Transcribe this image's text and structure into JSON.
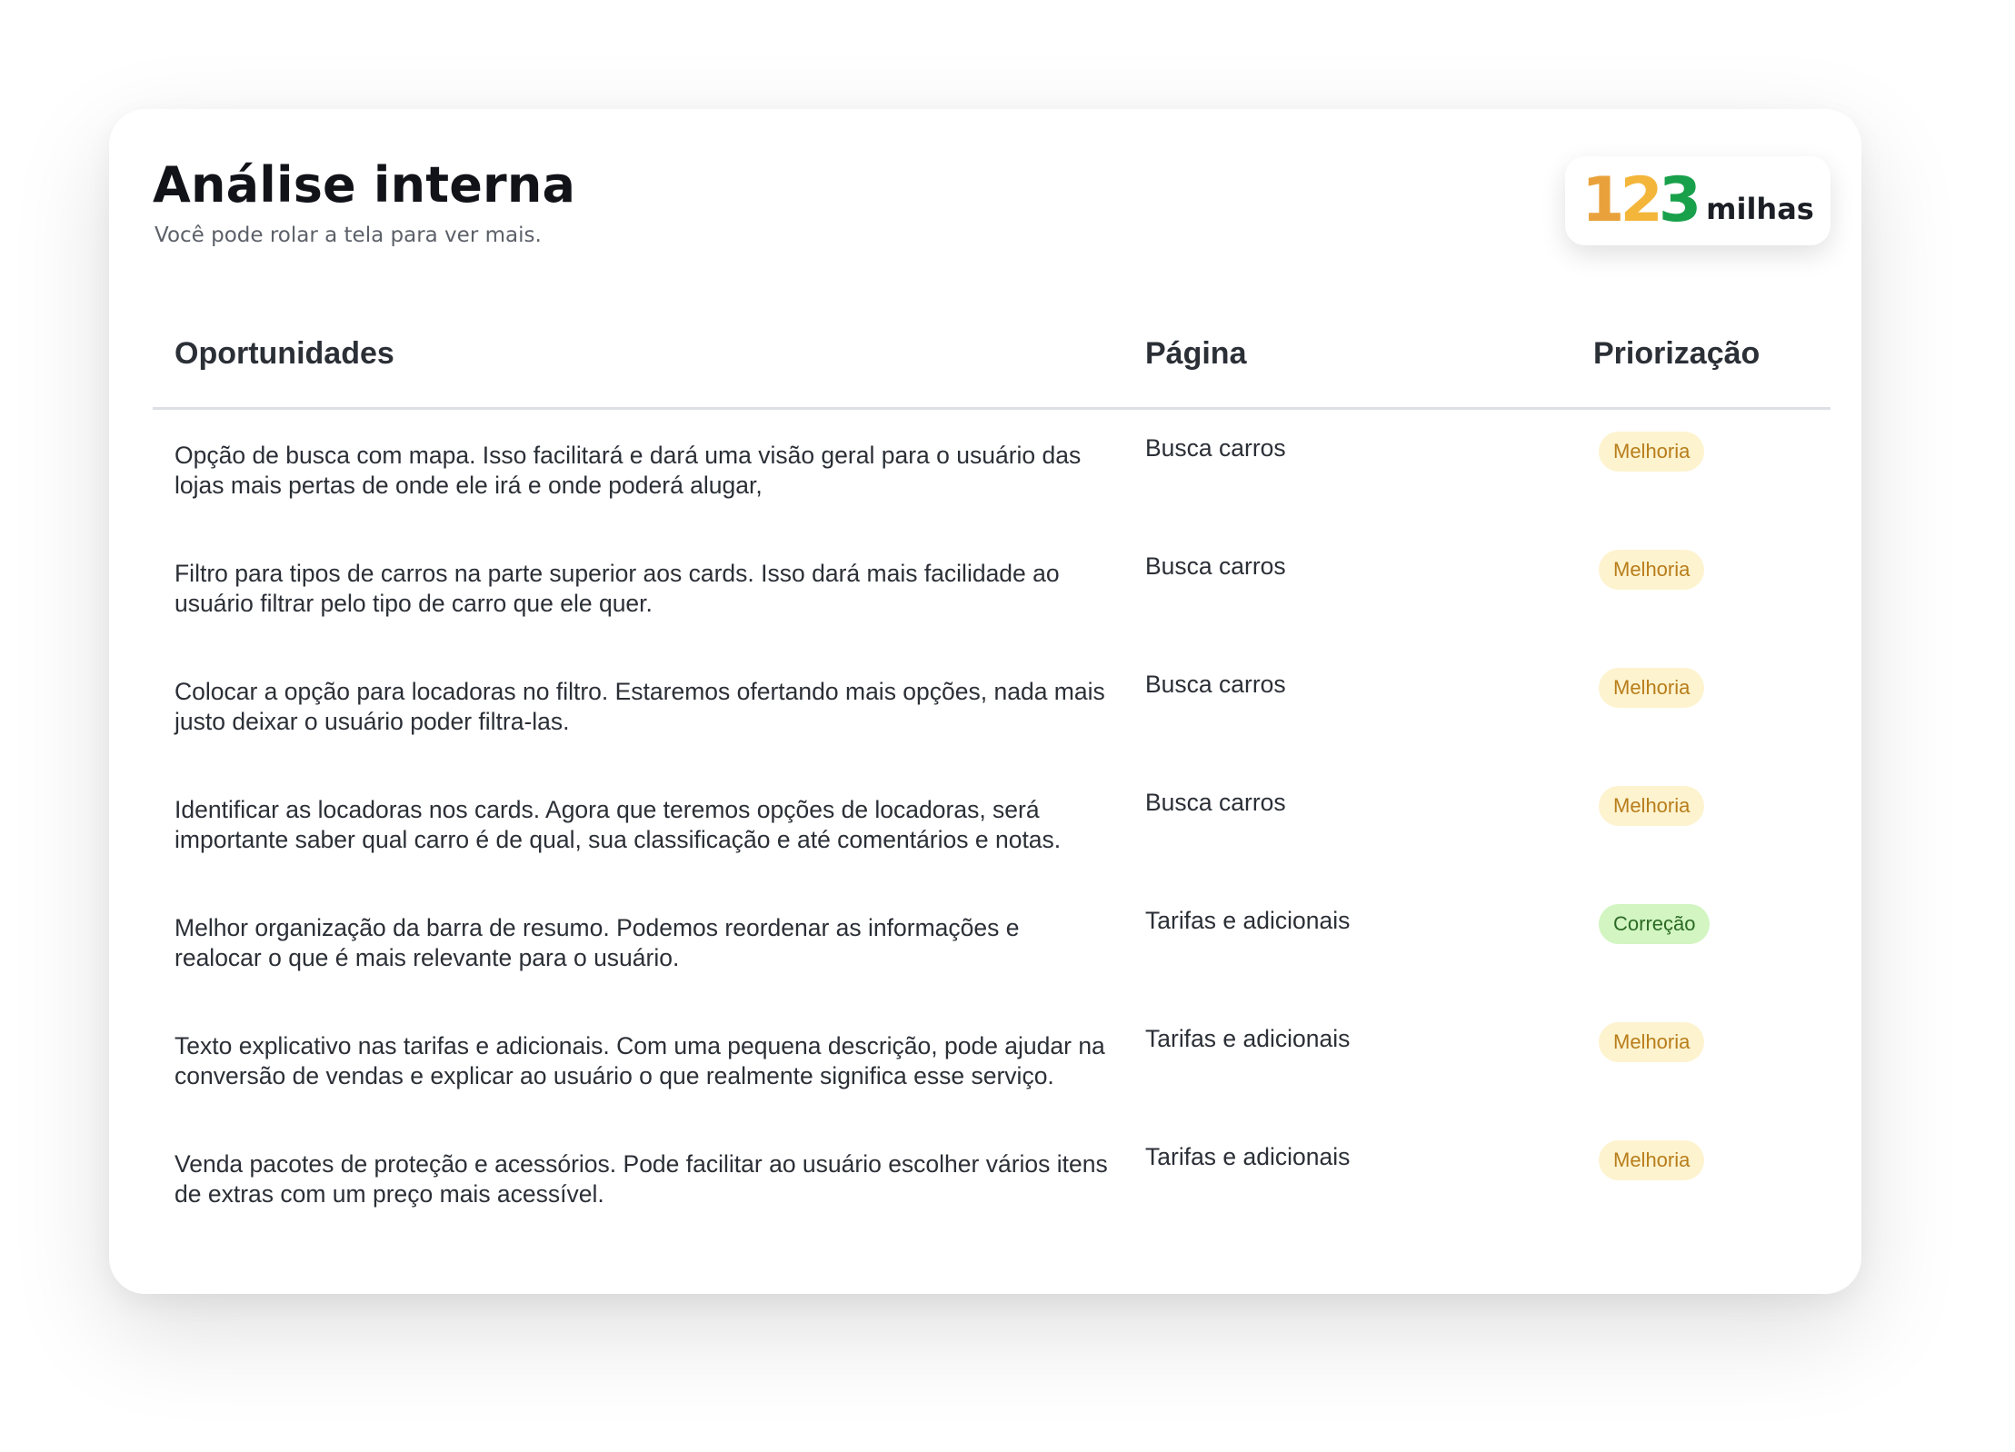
{
  "header": {
    "title": "Análise interna",
    "subtitle": "Você pode rolar a tela para ver mais."
  },
  "logo": {
    "digits": [
      "1",
      "2",
      "3"
    ],
    "word": "milhas",
    "colors": {
      "digit_1": "#e9a23b",
      "digit_2": "#f3b63a",
      "digit_3": "#19a04b"
    }
  },
  "table": {
    "columns": [
      "Oportunidades",
      "Página",
      "Priorização"
    ],
    "rows": [
      {
        "oportunidade": "Opção de busca com mapa. Isso facilitará e dará uma visão geral para o usuário das lojas mais pertas de onde ele irá e onde poderá alugar,",
        "pagina": "Busca carros",
        "priorizacao": "Melhoria"
      },
      {
        "oportunidade": "Filtro para tipos de carros na parte superior aos cards. Isso dará mais facilidade ao usuário filtrar pelo tipo de carro que ele quer.",
        "pagina": "Busca carros",
        "priorizacao": "Melhoria"
      },
      {
        "oportunidade": "Colocar a opção para locadoras no filtro. Estaremos ofertando mais opções, nada mais justo deixar o usuário poder filtra-las.",
        "pagina": "Busca carros",
        "priorizacao": "Melhoria"
      },
      {
        "oportunidade": "Identificar as locadoras nos cards. Agora que teremos opções de locadoras, será importante saber qual carro é de qual, sua classificação e até comentários e notas.",
        "pagina": "Busca carros",
        "priorizacao": "Melhoria"
      },
      {
        "oportunidade": "Melhor organização da barra de resumo. Podemos reordenar as informações e realocar o que é mais relevante para o usuário.",
        "pagina": "Tarifas e adicionais",
        "priorizacao": "Correção"
      },
      {
        "oportunidade": "Texto explicativo nas tarifas e adicionais. Com uma pequena descrição, pode ajudar na conversão de vendas e explicar ao usuário o que realmente significa esse serviço.",
        "pagina": "Tarifas e adicionais",
        "priorizacao": "Melhoria"
      },
      {
        "oportunidade": "Venda pacotes de proteção e acessórios. Pode facilitar ao usuário escolher vários itens de extras com um preço mais acessível.",
        "pagina": "Tarifas e adicionais",
        "priorizacao": "Melhoria"
      }
    ]
  },
  "badge_colors": {
    "Melhoria": {
      "bg": "#fdf3cf",
      "fg": "#b87d1a"
    },
    "Correção": {
      "bg": "#d2f5c2",
      "fg": "#2c6a24"
    }
  }
}
